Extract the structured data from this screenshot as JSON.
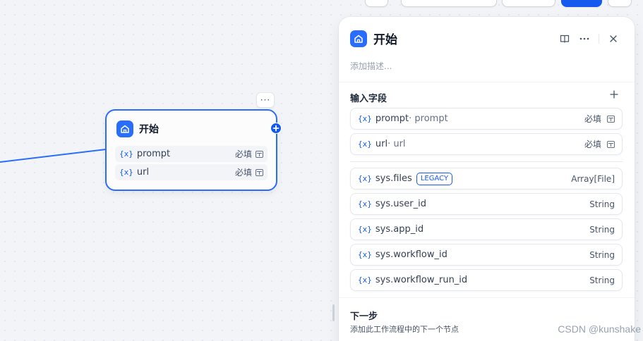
{
  "node": {
    "title": "开始",
    "more_label": "···",
    "variables": [
      {
        "name": "prompt",
        "required": "必填"
      },
      {
        "name": "url",
        "required": "必填"
      }
    ]
  },
  "panel": {
    "title": "开始",
    "description_placeholder": "添加描述...",
    "input_section_title": "输入字段",
    "input_fields": [
      {
        "name": "prompt",
        "alias": " · prompt",
        "required": "必填"
      },
      {
        "name": "url",
        "alias": " · url",
        "required": "必填"
      }
    ],
    "legacy_badge": "LEGACY",
    "system_fields": [
      {
        "name": "sys.files",
        "type": "Array[File]"
      },
      {
        "name": "sys.user_id",
        "type": "String"
      },
      {
        "name": "sys.app_id",
        "type": "String"
      },
      {
        "name": "sys.workflow_id",
        "type": "String"
      },
      {
        "name": "sys.workflow_run_id",
        "type": "String"
      }
    ],
    "next_title": "下一步",
    "next_description": "添加此工作流程中的下一个节点"
  },
  "var_marker": "{x}",
  "watermark": "CSDN @kunshake",
  "colors": {
    "accent": "#155aef",
    "node_border": "#296dff"
  },
  "icons": [
    "home-icon",
    "book-icon",
    "more-icon",
    "close-icon",
    "plus-icon",
    "text-type-icon",
    "variable-icon"
  ]
}
